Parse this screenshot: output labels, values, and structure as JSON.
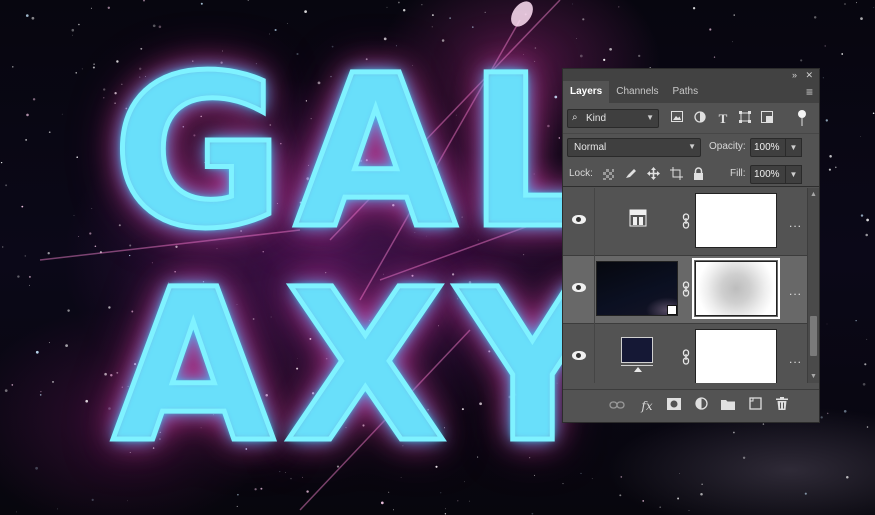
{
  "artwork": {
    "line_1": "GAL",
    "line_2": "AXY"
  },
  "layers_panel": {
    "collapse_glyph": "»",
    "close_glyph": "✕",
    "tabs": [
      "Layers",
      "Channels",
      "Paths"
    ],
    "active_tab": "Layers",
    "menu_glyph": "≡",
    "filter": {
      "kind_label": "Kind",
      "search_glyph": "⌕",
      "icons": [
        "image-filter-icon",
        "adjustment-filter-icon",
        "type-filter-icon",
        "shape-filter-icon",
        "smart-object-filter-icon"
      ]
    },
    "blend_mode": "Normal",
    "opacity_label": "Opacity:",
    "opacity_value": "100%",
    "lock_label": "Lock:",
    "fill_label": "Fill:",
    "fill_value": "100%",
    "layers": [
      {
        "type": "levels-adjustment",
        "visible": true,
        "has_mask": true,
        "selected": false
      },
      {
        "type": "smart-object-space-image",
        "visible": true,
        "has_mask": true,
        "selected": true
      },
      {
        "type": "solid-color-fill",
        "visible": true,
        "has_mask": true,
        "selected": false,
        "color": "#151835"
      }
    ],
    "more_glyph": "...",
    "footer_icons": [
      "link-layers-icon",
      "fx-icon",
      "add-mask-icon",
      "adjustment-layer-icon",
      "group-folder-icon",
      "new-layer-icon",
      "trash-icon"
    ],
    "fx_text": "fx"
  },
  "colors": {
    "panel_bg": "#535353",
    "panel_header": "#424242",
    "selected_row": "#686868",
    "glow_cyan": "#7ff2ff",
    "glow_pink": "#ff50c8"
  }
}
